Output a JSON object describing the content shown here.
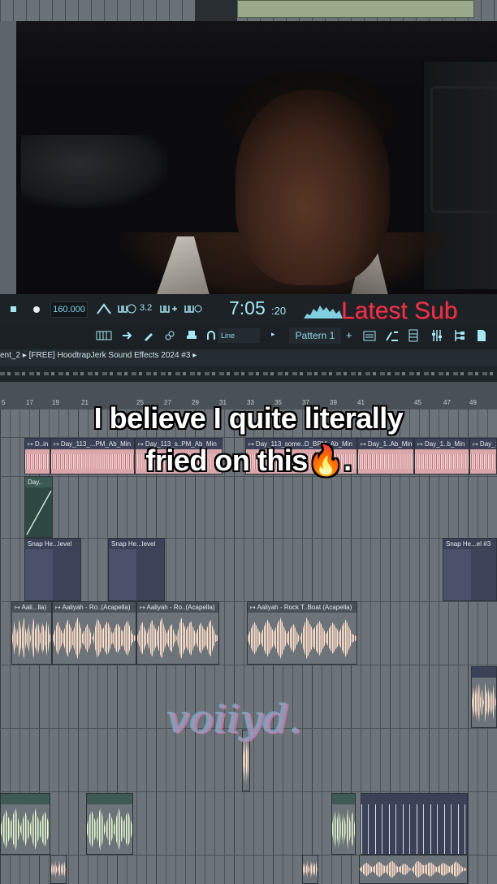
{
  "toolbar": {
    "bpm": "160.000",
    "time_main": "7:05",
    "time_sub": ":20",
    "channel_value": "3.2",
    "snap_mode": "Line",
    "pattern": "Pattern 1",
    "overlay_text": "Latest Sub"
  },
  "breadcrumb": {
    "text": "ent_2 ▸ [FREE] HoodtrapJerk Sound Effects 2024 #3 ▸"
  },
  "ruler": {
    "bars": [
      "5",
      "17",
      "19",
      "21",
      "25",
      "27",
      "29",
      "31",
      "33",
      "35",
      "37",
      "39",
      "41",
      "45",
      "47",
      "49"
    ]
  },
  "clips": {
    "row1": [
      {
        "label": "↦ D..in"
      },
      {
        "label": "↦ Day_113_...PM_Ab_Min"
      },
      {
        "label": "↦ Day_113_s..PM_Ab_Min"
      },
      {
        "label": "↦ Day_113_some..D_BPM_Ab_Min"
      },
      {
        "label": "↦ Day_1..Ab_Min"
      },
      {
        "label": "↦ Day_1..b_Min"
      },
      {
        "label": "↦ Day_1"
      }
    ],
    "auto_day": "Day..",
    "snap": [
      {
        "label": "Snap He...level"
      },
      {
        "label": "Snap He...level"
      },
      {
        "label": "Snap He...el #3"
      }
    ],
    "aaliyah": [
      {
        "label": "↦ Aali...lla)"
      },
      {
        "label": "↦ Aaliyah - Ro..(Acapella)"
      },
      {
        "label": "↦ Aaliyah - Ro..(Acapella)"
      },
      {
        "label": "↦ Aaliyah - Rock T..Boat (Acapella)"
      }
    ]
  },
  "caption": {
    "line1": "I believe I quite literally",
    "line2": "fried on this🔥."
  },
  "watermark": "voiiyd."
}
